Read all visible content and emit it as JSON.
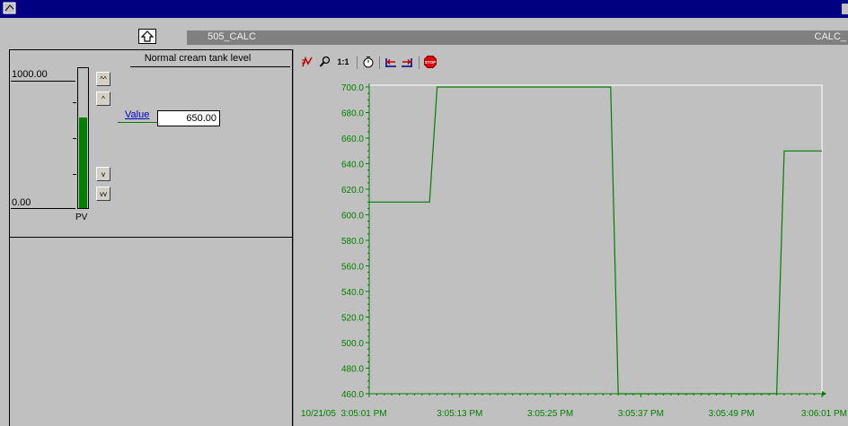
{
  "window": {
    "title": ""
  },
  "header": {
    "tag_name": "505_CALC",
    "tag_right": "CALC_"
  },
  "faceplate": {
    "description": "Normal cream tank level",
    "scale_max": "1000.00",
    "scale_min": "0.00",
    "pv_label": "PV",
    "pv_fraction": 0.65,
    "value_label": "Value",
    "value": "650.00",
    "buttons": {
      "fast_up": "^^",
      "up": "^",
      "down": "v",
      "fast_down": "vv"
    }
  },
  "toolbar": {
    "items": [
      "scale-icon",
      "zoom-icon",
      "1:1",
      "timer-icon",
      "scroll-back-icon",
      "scroll-forward-icon",
      "stop-icon"
    ],
    "one_to_one": "1:1",
    "stop": "STOP"
  },
  "colors": {
    "trace": "#008000",
    "axis_text": "#008000",
    "title_bar": "#000080",
    "bar": "#008000"
  },
  "chart_data": {
    "type": "line",
    "ylim": [
      460,
      700
    ],
    "y_ticks": [
      "700.0",
      "680.0",
      "660.0",
      "640.0",
      "620.0",
      "600.0",
      "580.0",
      "560.0",
      "540.0",
      "520.0",
      "500.0",
      "480.0",
      "460.0"
    ],
    "x_start_label": "10/21/05  3:05:01 PM",
    "x_ticks": [
      "3:05:13 PM",
      "3:05:25 PM",
      "3:05:37 PM",
      "3:05:49 PM",
      "3:06:01 PM"
    ],
    "xlim": [
      "3:05:01 PM",
      "3:06:01 PM"
    ],
    "series": [
      {
        "x": [
          "3:05:01 PM",
          "3:05:09 PM",
          "3:05:10 PM",
          "3:05:33 PM",
          "3:05:34 PM",
          "3:05:55 PM",
          "3:05:56 PM",
          "3:06:01 PM"
        ],
        "y": [
          610,
          610,
          700,
          700,
          460,
          460,
          650,
          650
        ]
      }
    ],
    "grid": false
  }
}
